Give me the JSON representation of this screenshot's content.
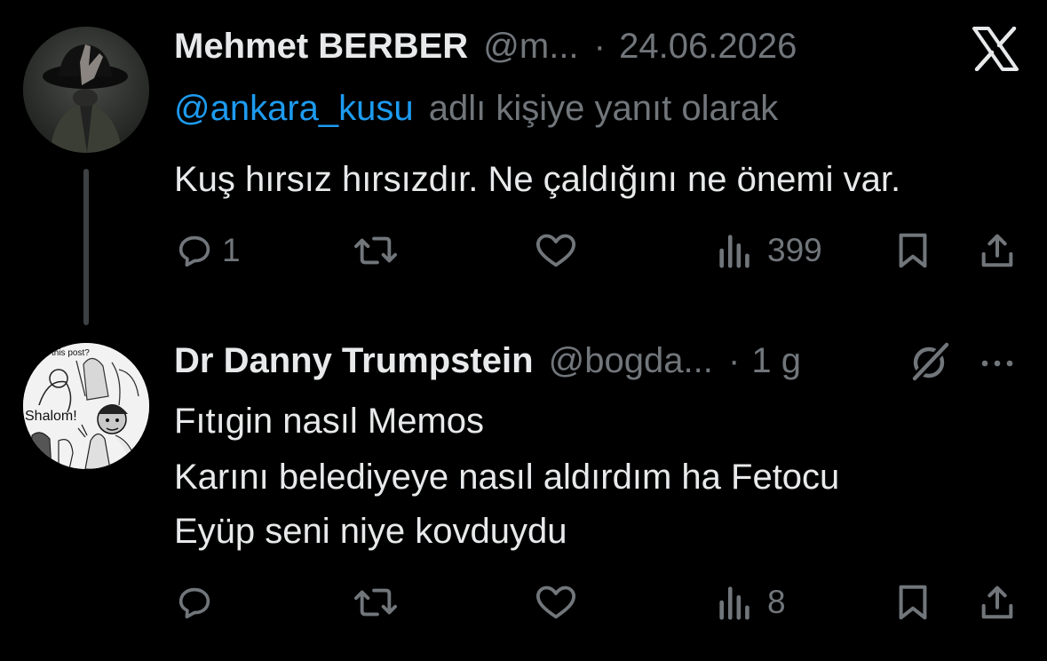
{
  "tweet1": {
    "author_name": "Mehmet BERBER",
    "handle": "@m...",
    "separator": "·",
    "date": "24.06.2026",
    "reply_mention": "@ankara_kusu",
    "reply_suffix": "adlı kişiye yanıt olarak",
    "text": "Kuş hırsız hırsızdır. Ne çaldığını ne önemi var.",
    "reply_count": "1",
    "retweet_count": "",
    "like_count": "",
    "view_count": "399"
  },
  "tweet2": {
    "author_name": "Dr Danny Trumpstein",
    "handle": "@bogda...",
    "separator": "·",
    "time": "1 g",
    "avatar_caption_top": "this post?",
    "avatar_caption": "Shalom!",
    "lines": [
      "Fıtıgin nasıl Memos",
      "Karını belediyeye nasıl aldırdım ha Fetocu",
      "Eyüp seni niye kovduydu"
    ],
    "reply_count": "",
    "retweet_count": "",
    "like_count": "",
    "view_count": "8"
  },
  "icons": {
    "logo": "x-logo-icon",
    "reply": "reply-icon",
    "retweet": "retweet-icon",
    "like": "heart-icon",
    "views": "views-icon",
    "bookmark": "bookmark-icon",
    "share": "share-icon",
    "grok": "grok-icon",
    "more": "more-icon"
  },
  "colors": {
    "background": "#000000",
    "text": "#e7e9ea",
    "muted": "#71767b",
    "link": "#1d9bf0"
  }
}
